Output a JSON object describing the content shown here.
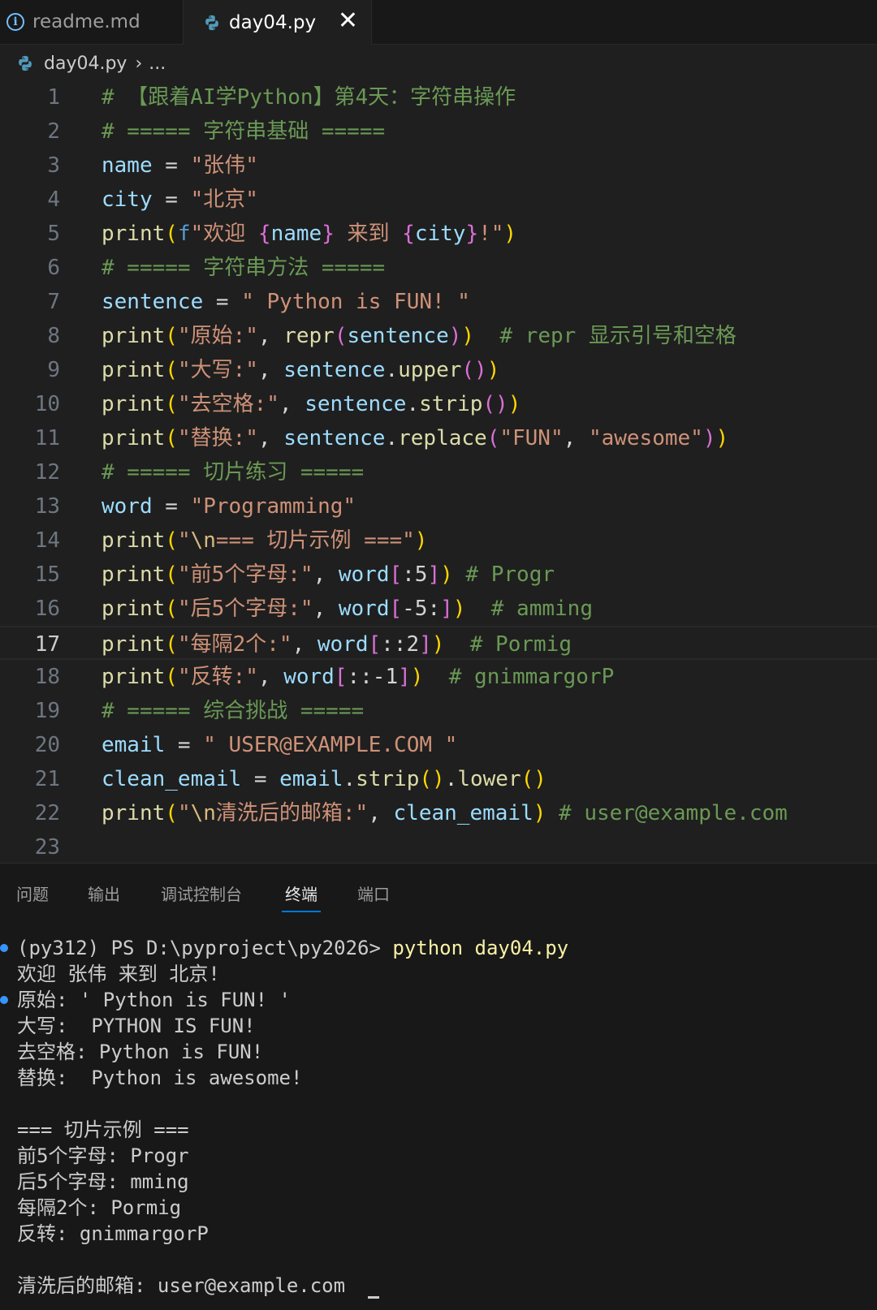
{
  "tabs": [
    {
      "label": "readme.md",
      "icon": "info-icon"
    },
    {
      "label": "day04.py",
      "icon": "python-icon",
      "active": true
    }
  ],
  "breadcrumb": {
    "file": "day04.py",
    "more": "..."
  },
  "editor": {
    "active_line": 17,
    "lines": [
      {
        "n": "1"
      },
      {
        "n": "2"
      },
      {
        "n": "3"
      },
      {
        "n": "4"
      },
      {
        "n": "5"
      },
      {
        "n": "6"
      },
      {
        "n": "7"
      },
      {
        "n": "8"
      },
      {
        "n": "9"
      },
      {
        "n": "10"
      },
      {
        "n": "11"
      },
      {
        "n": "12"
      },
      {
        "n": "13"
      },
      {
        "n": "14"
      },
      {
        "n": "15"
      },
      {
        "n": "16"
      },
      {
        "n": "17"
      },
      {
        "n": "18"
      },
      {
        "n": "19"
      },
      {
        "n": "20"
      },
      {
        "n": "21"
      },
      {
        "n": "22"
      },
      {
        "n": "23"
      }
    ],
    "code": {
      "l1": "# 【跟着AI学Python】第4天：字符串操作",
      "l2": "# ===== 字符串基础 =====",
      "l3_var": "name",
      "l3_op": " = ",
      "l3_str": "\"张伟\"",
      "l4_var": "city",
      "l4_op": " = ",
      "l4_str": "\"北京\"",
      "l5_fn": "print",
      "l5_open": "(",
      "l5_f": "f",
      "l5_s1": "\"欢迎 ",
      "l5_b1": "{",
      "l5_v1": "name",
      "l5_b2": "}",
      "l5_s2": " 来到 ",
      "l5_b3": "{",
      "l5_v2": "city",
      "l5_b4": "}",
      "l5_s3": "!\"",
      "l5_close": ")",
      "l6": "# ===== 字符串方法 =====",
      "l7_var": "sentence",
      "l7_op": " = ",
      "l7_str": "\" Python is FUN! \"",
      "l8_fn": "print",
      "l8_open": "(",
      "l8_str": "\"原始:\"",
      "l8_comma": ", ",
      "l8_fn2": "repr",
      "l8_open2": "(",
      "l8_var": "sentence",
      "l8_close2": ")",
      "l8_close": ")",
      "l8_comment": "  # repr 显示引号和空格",
      "l9_fn": "print",
      "l9_open": "(",
      "l9_str": "\"大写:\"",
      "l9_comma": ", ",
      "l9_var": "sentence",
      "l9_dot": ".",
      "l9_fn2": "upper",
      "l9_p": "()",
      "l9_close": ")",
      "l10_fn": "print",
      "l10_open": "(",
      "l10_str": "\"去空格:\"",
      "l10_comma": ", ",
      "l10_var": "sentence",
      "l10_dot": ".",
      "l10_fn2": "strip",
      "l10_p": "()",
      "l10_close": ")",
      "l11_fn": "print",
      "l11_open": "(",
      "l11_str": "\"替换:\"",
      "l11_comma": ", ",
      "l11_var": "sentence",
      "l11_dot": ".",
      "l11_fn2": "replace",
      "l11_open2": "(",
      "l11_s1": "\"FUN\"",
      "l11_comma2": ", ",
      "l11_s2": "\"awesome\"",
      "l11_close2": ")",
      "l11_close": ")",
      "l12": "# ===== 切片练习 =====",
      "l13_var": "word",
      "l13_op": " = ",
      "l13_str": "\"Programming\"",
      "l14_fn": "print",
      "l14_open": "(",
      "l14_q": "\"",
      "l14_esc": "\\n",
      "l14_str": "=== 切片示例 ===\"",
      "l14_close": ")",
      "l15_fn": "print",
      "l15_open": "(",
      "l15_str": "\"前5个字母:\"",
      "l15_comma": ", ",
      "l15_var": "word",
      "l15_b1": "[",
      "l15_idx": ":5",
      "l15_b2": "]",
      "l15_close": ")",
      "l15_comment": " # Progr",
      "l16_fn": "print",
      "l16_open": "(",
      "l16_str": "\"后5个字母:\"",
      "l16_comma": ", ",
      "l16_var": "word",
      "l16_b1": "[",
      "l16_idx": "-5:",
      "l16_b2": "]",
      "l16_close": ")",
      "l16_comment": "  # amming",
      "l17_fn": "print",
      "l17_open": "(",
      "l17_str": "\"每隔2个:\"",
      "l17_comma": ", ",
      "l17_var": "word",
      "l17_b1": "[",
      "l17_idx": "::2",
      "l17_b2": "]",
      "l17_close": ")",
      "l17_comment": "  # Pormig",
      "l18_fn": "print",
      "l18_open": "(",
      "l18_str": "\"反转:\"",
      "l18_comma": ", ",
      "l18_var": "word",
      "l18_b1": "[",
      "l18_idx": "::-1",
      "l18_b2": "]",
      "l18_close": ")",
      "l18_comment": "  # gnimmargorP",
      "l19": "# ===== 综合挑战 =====",
      "l20_var": "email",
      "l20_op": " = ",
      "l20_str": "\" USER@EXAMPLE.COM \"",
      "l21_var": "clean_email",
      "l21_op": " = ",
      "l21_var2": "email",
      "l21_dot": ".",
      "l21_fn": "strip",
      "l21_p": "()",
      "l21_dot2": ".",
      "l21_fn2": "lower",
      "l21_p2": "()",
      "l22_fn": "print",
      "l22_open": "(",
      "l22_q": "\"",
      "l22_esc": "\\n",
      "l22_str": "清洗后的邮箱:\"",
      "l22_comma": ", ",
      "l22_var": "clean_email",
      "l22_close": ")",
      "l22_comment": " # user@example.com"
    }
  },
  "panel": {
    "tabs": [
      "问题",
      "输出",
      "调试控制台",
      "终端",
      "端口"
    ],
    "active_tab": "终端",
    "terminal": {
      "prompt": "(py312) PS D:\\pyproject\\py2026> ",
      "command": "python day04.py",
      "output": [
        "欢迎 张伟 来到 北京!",
        "原始: ' Python is FUN! '",
        "大写:  PYTHON IS FUN!",
        "去空格: Python is FUN!",
        "替换:  Python is awesome!",
        "",
        "=== 切片示例 ===",
        "前5个字母: Progr",
        "后5个字母: mming",
        "每隔2个: Pormig",
        "反转: gnimmargorP",
        "",
        "清洗后的邮箱: user@example.com"
      ]
    }
  },
  "colors": {
    "accent": "#0078d4",
    "comment": "#6a9955",
    "variable": "#9cdcfe",
    "string": "#ce9178",
    "function": "#dcdcaa",
    "bracket1": "#ffd700",
    "bracket2": "#da70d6",
    "bracket3": "#179fff"
  }
}
